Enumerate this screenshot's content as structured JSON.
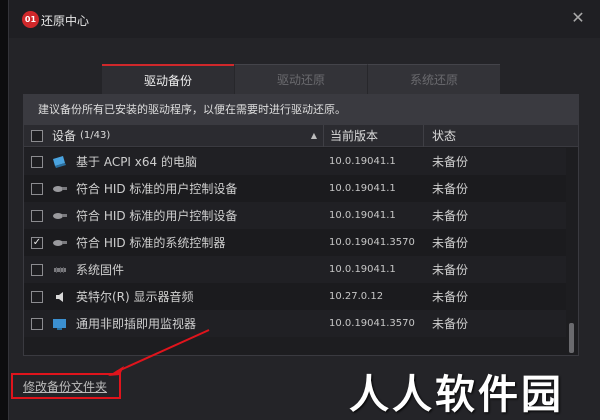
{
  "window": {
    "title": "还原中心",
    "logo_text": "01",
    "close_glyph": "✕"
  },
  "tabs": [
    {
      "label": "驱动备份",
      "active": true
    },
    {
      "label": "驱动还原",
      "active": false
    },
    {
      "label": "系统还原",
      "active": false
    }
  ],
  "panel": {
    "description": "建议备份所有已安装的驱动程序，以便在需要时进行驱动还原。",
    "columns": {
      "device": "设备",
      "count": "(1/43)",
      "version": "当前版本",
      "status": "状态"
    },
    "rows": [
      {
        "name": "基于 ACPI x64 的电脑",
        "version": "10.0.19041.1",
        "status": "未备份",
        "checked": false,
        "icon": "computer-icon"
      },
      {
        "name": "符合 HID 标准的用户控制设备",
        "version": "10.0.19041.1",
        "status": "未备份",
        "checked": false,
        "icon": "hid-device-icon"
      },
      {
        "name": "符合 HID 标准的用户控制设备",
        "version": "10.0.19041.1",
        "status": "未备份",
        "checked": false,
        "icon": "hid-device-icon"
      },
      {
        "name": "符合 HID 标准的系统控制器",
        "version": "10.0.19041.3570",
        "status": "未备份",
        "checked": true,
        "icon": "hid-device-icon"
      },
      {
        "name": "系统固件",
        "version": "10.0.19041.1",
        "status": "未备份",
        "checked": false,
        "icon": "firmware-icon"
      },
      {
        "name": "英特尔(R) 显示器音频",
        "version": "10.27.0.12",
        "status": "未备份",
        "checked": false,
        "icon": "audio-icon"
      },
      {
        "name": "通用非即插即用监视器",
        "version": "10.0.19041.3570",
        "status": "未备份",
        "checked": false,
        "icon": "monitor-icon"
      }
    ]
  },
  "footer": {
    "modify_backup_folder": "修改备份文件夹"
  },
  "overlay": {
    "watermark_text": "人人软件园"
  },
  "colors": {
    "accent": "#d0282b",
    "annotation": "#e0141c"
  }
}
